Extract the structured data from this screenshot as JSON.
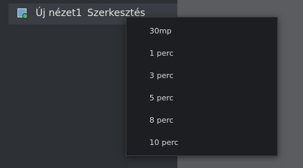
{
  "tab": {
    "icon": "view-icon",
    "title": "Új nézet1",
    "edit_label": "Szerkesztés"
  },
  "menu": {
    "items": [
      "30mp",
      "1 perc",
      "3 perc",
      "5 perc",
      "8 perc",
      "10 perc"
    ]
  },
  "colors": {
    "panel_bg": "#2d3035",
    "menu_bg": "#1c1e21",
    "text": "#d8d8d8"
  }
}
